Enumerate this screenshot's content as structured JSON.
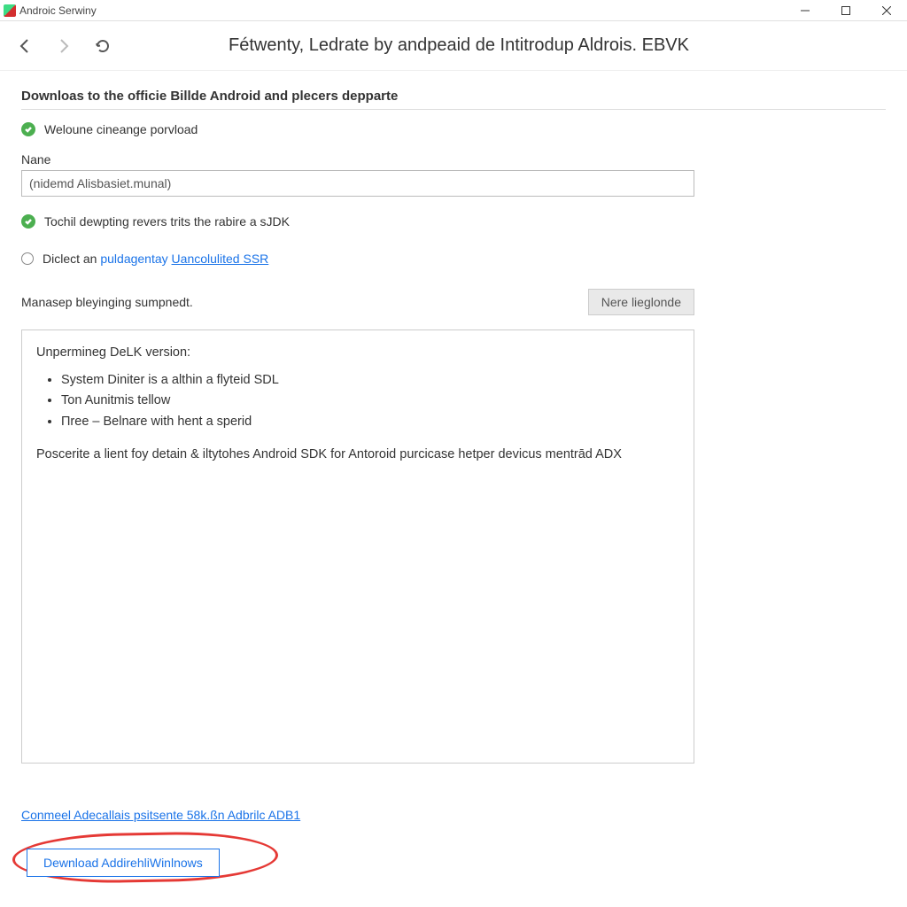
{
  "window": {
    "title": "Androic Serwiny"
  },
  "page": {
    "heading": "Fétwenty, Ledrate by andpeaid de Intitrodup Aldrois. EBVK"
  },
  "section": {
    "title": "Downloas to the officie Billde Android and plecers depparte"
  },
  "checks": {
    "first": "Weloune cineange porvload",
    "second": "Tochil dewpting revers trits the rabire a sJDK"
  },
  "field": {
    "label": "Nane",
    "value": "(nidemd Alisbasiet.munal)"
  },
  "radio": {
    "text_prefix": "Diclect an ",
    "link1": "puldagentay ",
    "link2": "Uancolulited SSR"
  },
  "manage": {
    "label": "Manasep bleyinging sumpnedt.",
    "button": "Nere lieglonde"
  },
  "info": {
    "heading": "Unpermineg DeLK version:",
    "items": [
      "System Diniter is a althin a flyteid SDL",
      "Ton Aunitmis tellow",
      "Пree – Belnare with hent a sperid"
    ],
    "footer": "Poscerite a lient foy detain & iltytohes Android SDK for Antoroid purcicase hetper devicus mentrād ADX"
  },
  "footer": {
    "link": "Conmeel Adecallais psitsente 58k.ßn Adbrilc ADB1",
    "download_button": "Dewnload AddirehliWinlnows"
  }
}
